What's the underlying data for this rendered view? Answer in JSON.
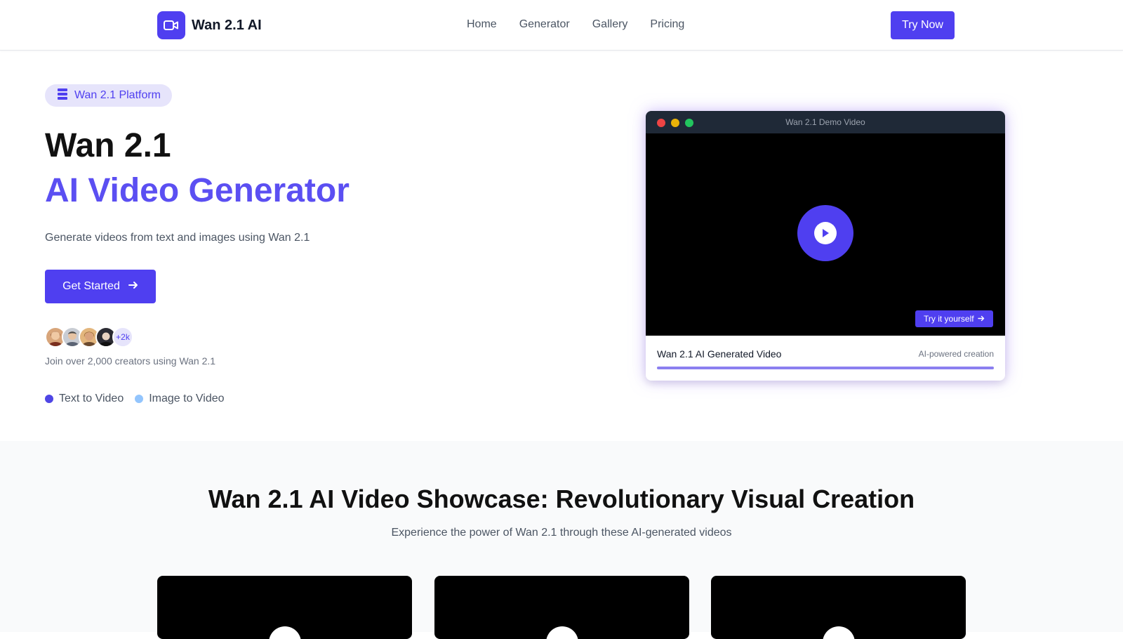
{
  "nav": {
    "brand_name": "Wan 2.1 AI",
    "links": [
      "Home",
      "Generator",
      "Gallery",
      "Pricing"
    ],
    "cta": "Try Now"
  },
  "hero": {
    "badge": "Wan 2.1 Platform",
    "title": "Wan 2.1",
    "subtitle": "AI Video Generator",
    "description": "Generate videos from text and images using Wan 2.1",
    "cta": "Get Started",
    "avatars_more": "+2k",
    "join_text": "Join over 2,000 creators using Wan 2.1",
    "features": [
      {
        "label": "Text to Video",
        "color": "#4f46e5"
      },
      {
        "label": "Image to Video",
        "color": "#93c5fd"
      }
    ]
  },
  "video_card": {
    "window_title": "Wan 2.1 Demo Video",
    "try_button": "Try it yourself",
    "caption": "Wan 2.1 AI Generated Video",
    "caption_right": "AI-powered creation",
    "progress": 1.0
  },
  "showcase": {
    "title": "Wan 2.1 AI Video Showcase: Revolutionary Visual Creation",
    "subtitle": "Experience the power of Wan 2.1 through these AI-generated videos"
  },
  "colors": {
    "accent": "#4f3ff0",
    "accent_light": "#5b4ff2",
    "badge_bg": "#e6e4fb"
  }
}
